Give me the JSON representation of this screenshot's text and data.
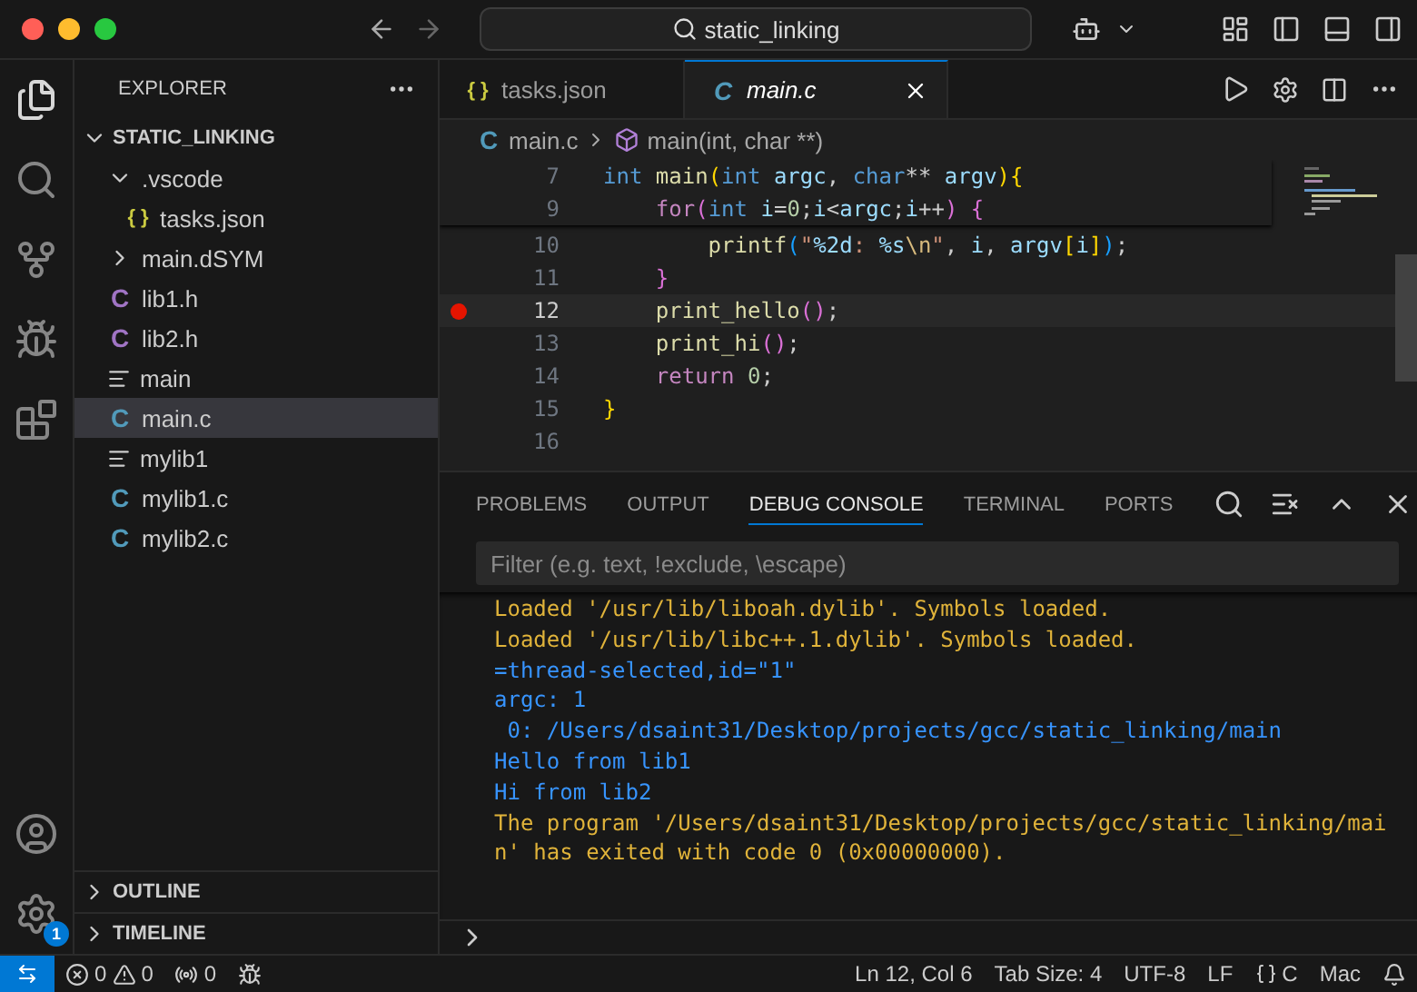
{
  "title_bar": {
    "search": "static_linking"
  },
  "sidebar": {
    "header": "EXPLORER",
    "folder": {
      "label": "STATIC_LINKING",
      "expanded": true,
      "children": [
        {
          "label": ".vscode",
          "kind": "folder",
          "expanded": true,
          "selected": false,
          "children": [
            {
              "label": "tasks.json",
              "kind": "json",
              "glyph": "{ }",
              "selected": false
            }
          ]
        },
        {
          "label": "main.dSYM",
          "kind": "folder",
          "expanded": false,
          "selected": false
        },
        {
          "label": "lib1.h",
          "kind": "header",
          "glyph": "C",
          "selected": false
        },
        {
          "label": "lib2.h",
          "kind": "header",
          "glyph": "C",
          "selected": false
        },
        {
          "label": "main",
          "kind": "binary",
          "selected": false
        },
        {
          "label": "main.c",
          "kind": "source",
          "glyph": "C",
          "selected": true
        },
        {
          "label": "mylib1",
          "kind": "binary",
          "selected": false
        },
        {
          "label": "mylib1.c",
          "kind": "source",
          "glyph": "C",
          "selected": false
        },
        {
          "label": "mylib2.c",
          "kind": "source",
          "glyph": "C",
          "selected": false
        }
      ]
    },
    "sections": [
      {
        "label": "OUTLINE",
        "expanded": false
      },
      {
        "label": "TIMELINE",
        "expanded": false
      }
    ]
  },
  "activity": {
    "manage_badge": "1"
  },
  "tabs": [
    {
      "label": "tasks.json",
      "kind": "json",
      "glyph": "{ }",
      "selected": false
    },
    {
      "label": "main.c",
      "kind": "source",
      "glyph": "C",
      "selected": true
    }
  ],
  "breadcrumb": [
    {
      "kind": "file",
      "glyph": "C",
      "label": "main.c"
    },
    {
      "kind": "symbol",
      "label": "main(int, char **)"
    }
  ],
  "editor": {
    "sticky_lines": [
      {
        "number": "7",
        "tokens": [
          {
            "text": "int",
            "kind": "type"
          },
          {
            "text": " main",
            "kind": "func"
          },
          {
            "text": "(",
            "kind": "b1"
          },
          {
            "text": "int",
            "kind": "type"
          },
          {
            "text": " argc",
            "kind": "var"
          },
          {
            "text": ", ",
            "kind": "plain"
          },
          {
            "text": "char",
            "kind": "type"
          },
          {
            "text": "**",
            "kind": "plain"
          },
          {
            "text": " argv",
            "kind": "var"
          },
          {
            "text": ")",
            "kind": "b1"
          },
          {
            "text": "{",
            "kind": "b1"
          }
        ]
      },
      {
        "number": "9",
        "tokens": [
          {
            "text": "    for",
            "kind": "kw"
          },
          {
            "text": "(",
            "kind": "b2"
          },
          {
            "text": "int",
            "kind": "type"
          },
          {
            "text": " i",
            "kind": "var"
          },
          {
            "text": "=",
            "kind": "plain"
          },
          {
            "text": "0",
            "kind": "num"
          },
          {
            "text": ";",
            "kind": "plain"
          },
          {
            "text": "i",
            "kind": "var"
          },
          {
            "text": "<",
            "kind": "plain"
          },
          {
            "text": "argc",
            "kind": "var"
          },
          {
            "text": ";",
            "kind": "plain"
          },
          {
            "text": "i",
            "kind": "var"
          },
          {
            "text": "++",
            "kind": "plain"
          },
          {
            "text": ")",
            "kind": "b2"
          },
          {
            "text": " {",
            "kind": "b2"
          }
        ]
      }
    ],
    "lines": [
      {
        "number": "10",
        "breakpoint": false,
        "current": false,
        "tokens": [
          {
            "text": "        printf",
            "kind": "func"
          },
          {
            "text": "(",
            "kind": "b3"
          },
          {
            "text": "\"",
            "kind": "str"
          },
          {
            "text": "%2d",
            "kind": "fmt"
          },
          {
            "text": ": ",
            "kind": "str"
          },
          {
            "text": "%s",
            "kind": "fmt"
          },
          {
            "text": "\\n",
            "kind": "esc"
          },
          {
            "text": "\"",
            "kind": "str"
          },
          {
            "text": ", ",
            "kind": "plain"
          },
          {
            "text": "i",
            "kind": "var"
          },
          {
            "text": ", ",
            "kind": "plain"
          },
          {
            "text": "argv",
            "kind": "var"
          },
          {
            "text": "[",
            "kind": "b1"
          },
          {
            "text": "i",
            "kind": "var"
          },
          {
            "text": "]",
            "kind": "b1"
          },
          {
            "text": ")",
            "kind": "b3"
          },
          {
            "text": ";",
            "kind": "plain"
          }
        ]
      },
      {
        "number": "11",
        "breakpoint": false,
        "current": false,
        "tokens": [
          {
            "text": "    }",
            "kind": "b2"
          }
        ]
      },
      {
        "number": "12",
        "breakpoint": true,
        "current": true,
        "tokens": [
          {
            "text": "    print_hello",
            "kind": "func"
          },
          {
            "text": "(",
            "kind": "b2"
          },
          {
            "text": ")",
            "kind": "b2"
          },
          {
            "text": ";",
            "kind": "plain"
          }
        ]
      },
      {
        "number": "13",
        "breakpoint": false,
        "current": false,
        "tokens": [
          {
            "text": "    print_hi",
            "kind": "func"
          },
          {
            "text": "(",
            "kind": "b2"
          },
          {
            "text": ")",
            "kind": "b2"
          },
          {
            "text": ";",
            "kind": "plain"
          }
        ]
      },
      {
        "number": "14",
        "breakpoint": false,
        "current": false,
        "tokens": [
          {
            "text": "    return",
            "kind": "kw"
          },
          {
            "text": " 0",
            "kind": "num"
          },
          {
            "text": ";",
            "kind": "plain"
          }
        ]
      },
      {
        "number": "15",
        "breakpoint": false,
        "current": false,
        "tokens": [
          {
            "text": "}",
            "kind": "b1"
          }
        ]
      },
      {
        "number": "16",
        "breakpoint": false,
        "current": false
      }
    ]
  },
  "panel": {
    "tabs": [
      {
        "label": "PROBLEMS",
        "selected": false
      },
      {
        "label": "OUTPUT",
        "selected": false
      },
      {
        "label": "DEBUG CONSOLE",
        "selected": true
      },
      {
        "label": "TERMINAL",
        "selected": false
      },
      {
        "label": "PORTS",
        "selected": false
      }
    ],
    "filter": {
      "placeholder": "Filter (e.g. text, !exclude, \\escape)"
    },
    "console": [
      {
        "kind": "log",
        "text": "Loaded '/usr/lib/liboah.dylib'. Symbols loaded."
      },
      {
        "kind": "log",
        "text": "Loaded '/usr/lib/libc++.1.dylib'. Symbols loaded."
      },
      {
        "kind": "info",
        "text": "=thread-selected,id=\"1\""
      },
      {
        "kind": "info",
        "text": "argc: 1"
      },
      {
        "kind": "info",
        "text": " 0: /Users/dsaint31/Desktop/projects/gcc/static_linking/main"
      },
      {
        "kind": "info",
        "text": "Hello from lib1"
      },
      {
        "kind": "info",
        "text": "Hi from lib2"
      },
      {
        "kind": "log",
        "text": "The program '/Users/dsaint31/Desktop/projects/gcc/static_linking/main' has exited with code 0 (0x00000000)."
      }
    ]
  },
  "status_bar": {
    "errors": "0",
    "warnings": "0",
    "ports": "0",
    "position": "Ln 12, Col 6",
    "tab_size": "Tab Size: 4",
    "encoding": "UTF-8",
    "eol": "LF",
    "language": "C",
    "platform": "Mac"
  }
}
